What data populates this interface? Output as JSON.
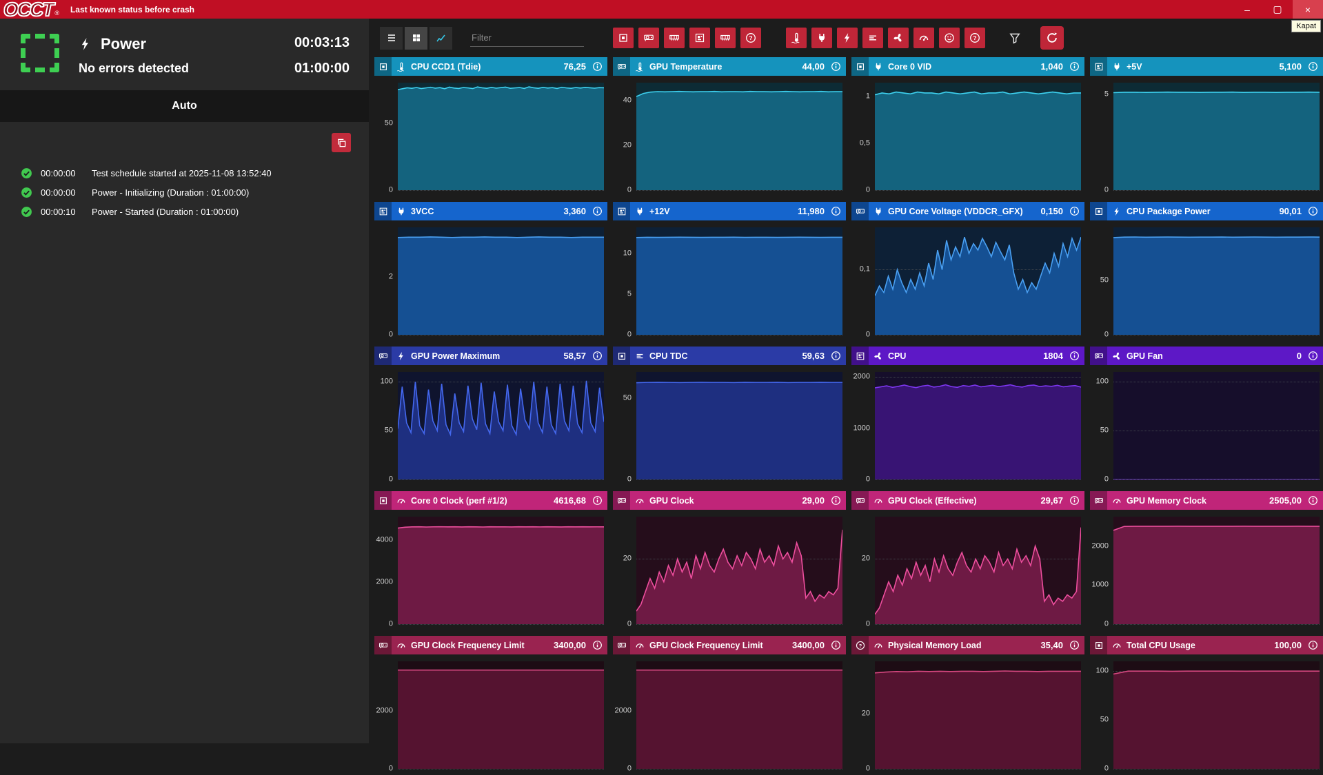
{
  "titlebar": {
    "app_name": "OCCT",
    "registered_mark": "®",
    "status_message": "Last known status before crash",
    "window_controls": {
      "minimize": "–",
      "maximize": "▢",
      "close": "×"
    },
    "close_tooltip": "Kapat"
  },
  "sidebar": {
    "test_type": "Power",
    "status": "No errors detected",
    "elapsed": "00:03:13",
    "total": "01:00:00",
    "mode_label": "Auto",
    "log": [
      {
        "time": "00:00:00",
        "message": "Test schedule started at 2025-11-08 13:52:40"
      },
      {
        "time": "00:00:00",
        "message": "Power - Initializing (Duration : 01:00:00)"
      },
      {
        "time": "00:00:10",
        "message": "Power - Started (Duration : 01:00:00)"
      }
    ]
  },
  "toolbar": {
    "filter_placeholder": "Filter",
    "view_buttons": [
      "list-view",
      "grid-view",
      "chart-view"
    ],
    "active_view": "grid-view",
    "source_filters": [
      "cpu",
      "gpu",
      "memory",
      "mainboard",
      "dimm",
      "unknown"
    ],
    "type_filters": [
      "temperature",
      "voltage",
      "power",
      "current",
      "fan",
      "frequency",
      "load",
      "unknown"
    ]
  },
  "themes": {
    "teal": {
      "header": "#1593bd",
      "plot_bg": "#0d2b35",
      "fill": "#14637e",
      "line": "#3ed2f0"
    },
    "blue": {
      "header": "#1565cd",
      "plot_bg": "#0d2036",
      "fill": "#155093",
      "line": "#4aa0f2"
    },
    "navy": {
      "header": "#2b3ba6",
      "plot_bg": "#0f142e",
      "fill": "#1e2f80",
      "line": "#4468ee"
    },
    "purple": {
      "header": "#5d18c6",
      "plot_bg": "#160e2b",
      "fill": "#381474",
      "line": "#7c36ee"
    },
    "magenta": {
      "header": "#c02579",
      "plot_bg": "#250d1b",
      "fill": "#6e1a44",
      "line": "#ee4f9e"
    },
    "maroon": {
      "header": "#9a2350",
      "plot_bg": "#1d0c14",
      "fill": "#551330",
      "line": "#d64880"
    }
  },
  "charts": [
    {
      "name": "CPU CCD1 (Tdie)",
      "value": "76,25",
      "theme": "teal",
      "source": "cpu",
      "type": "temperature",
      "ymax": 80,
      "ticks": [
        {
          "value": 50,
          "label": "50"
        },
        {
          "value": 0,
          "label": "0"
        }
      ],
      "series": [
        74.8,
        75.5,
        76.2,
        75.8,
        76.4,
        75.6,
        76.1,
        76.6,
        75.9,
        76.3,
        75.5,
        76.7,
        76.0,
        75.7,
        76.4,
        76.1,
        75.6,
        76.8,
        76.2,
        75.8,
        76.5,
        75.9,
        76.3,
        76.7,
        75.8,
        76.1,
        76.4,
        75.7,
        76.9,
        76.2,
        75.8,
        76.5,
        76.0,
        76.3,
        75.7,
        76.6,
        76.1,
        75.8,
        76.4,
        76.0,
        76.5,
        76.2,
        75.9,
        76.3,
        76.2
      ]
    },
    {
      "name": "GPU Temperature",
      "value": "44,00",
      "theme": "teal",
      "source": "gpu",
      "type": "temperature",
      "ymax": 48,
      "ticks": [
        {
          "value": 40,
          "label": "40"
        },
        {
          "value": 20,
          "label": "20"
        },
        {
          "value": 0,
          "label": "0"
        }
      ],
      "series": [
        41.8,
        43.2,
        43.8,
        44,
        43.9,
        44,
        44.1,
        44,
        43.9,
        44,
        44,
        44.1,
        43.9,
        44,
        44,
        43.9,
        44.1,
        44,
        44,
        43.9,
        44,
        44.1,
        44,
        43.9,
        44,
        44,
        44.1,
        43.9,
        44,
        44
      ]
    },
    {
      "name": "Core 0 VID",
      "value": "1,040",
      "theme": "teal",
      "source": "cpu",
      "type": "voltage",
      "ymax": 1.15,
      "ticks": [
        {
          "value": 1,
          "label": "1"
        },
        {
          "value": 0.5,
          "label": "0,5"
        },
        {
          "value": 0,
          "label": "0"
        }
      ],
      "series": [
        1.02,
        1.04,
        1.03,
        1.05,
        1.04,
        1.03,
        1.05,
        1.04,
        1.04,
        1.03,
        1.05,
        1.04,
        1.03,
        1.04,
        1.05,
        1.03,
        1.04,
        1.04,
        1.05,
        1.03,
        1.04,
        1.05,
        1.04,
        1.03,
        1.04,
        1.05,
        1.04,
        1.03,
        1.04,
        1.04
      ]
    },
    {
      "name": "+5V",
      "value": "5,100",
      "theme": "teal",
      "source": "mainboard",
      "type": "voltage",
      "ymax": 5.6,
      "ticks": [
        {
          "value": 5,
          "label": "5"
        },
        {
          "value": 0,
          "label": "0"
        }
      ],
      "series": [
        5.08,
        5.1,
        5.1,
        5.09,
        5.1,
        5.11,
        5.1,
        5.1,
        5.09,
        5.1,
        5.1,
        5.11,
        5.09,
        5.1,
        5.1,
        5.09,
        5.1,
        5.1,
        5.11,
        5.1
      ]
    },
    {
      "name": "3VCC",
      "value": "3,360",
      "theme": "blue",
      "source": "mainboard",
      "type": "voltage",
      "ymax": 3.7,
      "ticks": [
        {
          "value": 2,
          "label": "2"
        },
        {
          "value": 0,
          "label": "0"
        }
      ],
      "series": [
        3.35,
        3.36,
        3.36,
        3.37,
        3.36,
        3.35,
        3.36,
        3.36,
        3.37,
        3.36,
        3.36,
        3.35,
        3.36,
        3.37,
        3.36,
        3.36,
        3.35,
        3.36,
        3.36,
        3.36
      ]
    },
    {
      "name": "+12V",
      "value": "11,980",
      "theme": "blue",
      "source": "mainboard",
      "type": "voltage",
      "ymax": 13.2,
      "ticks": [
        {
          "value": 10,
          "label": "10"
        },
        {
          "value": 5,
          "label": "5"
        },
        {
          "value": 0,
          "label": "0"
        }
      ],
      "series": [
        11.95,
        11.98,
        11.97,
        11.98,
        11.99,
        11.98,
        11.97,
        11.98,
        11.98,
        11.99,
        11.97,
        11.98,
        11.98,
        11.97,
        11.98,
        11.99,
        11.98,
        11.97,
        11.98,
        11.98
      ]
    },
    {
      "name": "GPU Core Voltage (VDDCR_GFX)",
      "value": "0,150",
      "theme": "blue",
      "source": "gpu",
      "type": "voltage",
      "ymax": 0.165,
      "ticks": [
        {
          "value": 0.1,
          "label": "0,1"
        },
        {
          "value": 0,
          "label": "0"
        }
      ],
      "series": [
        0.06,
        0.075,
        0.065,
        0.09,
        0.07,
        0.1,
        0.08,
        0.065,
        0.085,
        0.07,
        0.095,
        0.075,
        0.11,
        0.085,
        0.13,
        0.1,
        0.145,
        0.115,
        0.135,
        0.12,
        0.15,
        0.125,
        0.14,
        0.13,
        0.148,
        0.135,
        0.12,
        0.142,
        0.128,
        0.115,
        0.138,
        0.095,
        0.07,
        0.085,
        0.065,
        0.08,
        0.07,
        0.09,
        0.11,
        0.095,
        0.125,
        0.105,
        0.14,
        0.12,
        0.148,
        0.13,
        0.15
      ]
    },
    {
      "name": "CPU Package Power",
      "value": "90,01",
      "theme": "blue",
      "source": "cpu",
      "type": "power",
      "ymax": 99,
      "ticks": [
        {
          "value": 50,
          "label": "50"
        },
        {
          "value": 0,
          "label": "0"
        }
      ],
      "series": [
        89.5,
        90,
        90.1,
        89.9,
        90,
        90.1,
        90,
        89.9,
        90,
        90,
        90.1,
        89.9,
        90,
        90.1,
        90,
        89.9,
        90,
        90,
        90.1,
        90
      ]
    },
    {
      "name": "GPU Power Maximum",
      "value": "58,57",
      "theme": "navy",
      "source": "gpu",
      "type": "power",
      "ymax": 110,
      "ticks": [
        {
          "value": 100,
          "label": "100"
        },
        {
          "value": 50,
          "label": "50"
        },
        {
          "value": 0,
          "label": "0"
        }
      ],
      "series": [
        52,
        95,
        58,
        48,
        100,
        55,
        47,
        92,
        60,
        50,
        98,
        56,
        46,
        88,
        58,
        49,
        96,
        62,
        51,
        99,
        57,
        47,
        90,
        59,
        50,
        97,
        55,
        46,
        93,
        61,
        52,
        100,
        58,
        48,
        95,
        56,
        47,
        98,
        60,
        50,
        96,
        57,
        48,
        101,
        58,
        49,
        94,
        59
      ]
    },
    {
      "name": "CPU TDC",
      "value": "59,63",
      "theme": "navy",
      "source": "cpu",
      "type": "current",
      "ymax": 66,
      "ticks": [
        {
          "value": 50,
          "label": "50"
        },
        {
          "value": 0,
          "label": "0"
        }
      ],
      "series": [
        59.4,
        59.6,
        59.7,
        59.6,
        59.5,
        59.6,
        59.7,
        59.6,
        59.6,
        59.5,
        59.7,
        59.6,
        59.6,
        59.7,
        59.5,
        59.6,
        59.6,
        59.7,
        59.6,
        59.6
      ]
    },
    {
      "name": "CPU",
      "value": "1804",
      "theme": "purple",
      "source": "mainboard",
      "type": "fan",
      "ymax": 2100,
      "ticks": [
        {
          "value": 2000,
          "label": "2000"
        },
        {
          "value": 1000,
          "label": "1000"
        },
        {
          "value": 0,
          "label": "0"
        }
      ],
      "series": [
        1790,
        1810,
        1830,
        1800,
        1820,
        1845,
        1815,
        1795,
        1825,
        1840,
        1805,
        1820,
        1850,
        1815,
        1800,
        1835,
        1820,
        1845,
        1810,
        1825,
        1840,
        1815,
        1830,
        1850,
        1820,
        1805,
        1835,
        1845,
        1815,
        1830,
        1820,
        1840,
        1810,
        1825,
        1835,
        1804
      ]
    },
    {
      "name": "GPU Fan",
      "value": "0",
      "theme": "purple",
      "source": "gpu",
      "type": "fan",
      "ymax": 110,
      "ticks": [
        {
          "value": 100,
          "label": "100"
        },
        {
          "value": 50,
          "label": "50"
        },
        {
          "value": 0,
          "label": "0"
        }
      ],
      "series": [
        0,
        0,
        0,
        0,
        0,
        0,
        0,
        0,
        0,
        0,
        0,
        0,
        0,
        0,
        0
      ]
    },
    {
      "name": "Core 0 Clock (perf #1/2)",
      "value": "4616,68",
      "theme": "magenta",
      "source": "cpu",
      "type": "frequency",
      "ymax": 5100,
      "ticks": [
        {
          "value": 4000,
          "label": "4000"
        },
        {
          "value": 2000,
          "label": "2000"
        },
        {
          "value": 0,
          "label": "0"
        }
      ],
      "series": [
        4560,
        4600,
        4615,
        4620,
        4610,
        4618,
        4622,
        4615,
        4619,
        4612,
        4620,
        4616,
        4610,
        4621,
        4615,
        4618,
        4613,
        4620,
        4616,
        4619,
        4614,
        4621,
        4617,
        4612,
        4619,
        4616,
        4620,
        4615,
        4618,
        4617
      ]
    },
    {
      "name": "GPU Clock",
      "value": "29,00",
      "theme": "magenta",
      "source": "gpu",
      "type": "frequency",
      "ymax": 33,
      "ticks": [
        {
          "value": 20,
          "label": "20"
        },
        {
          "value": 0,
          "label": "0"
        }
      ],
      "series": [
        4,
        6,
        10,
        14,
        11,
        16,
        13,
        18,
        15,
        20,
        16,
        19,
        14,
        21,
        17,
        22,
        18,
        16,
        20,
        23,
        19,
        17,
        21,
        18,
        22,
        20,
        17,
        23,
        19,
        21,
        18,
        24,
        20,
        22,
        19,
        25,
        21,
        8,
        10,
        7,
        9,
        8,
        10,
        9,
        11,
        29
      ]
    },
    {
      "name": "GPU Clock (Effective)",
      "value": "29,67",
      "theme": "magenta",
      "source": "gpu",
      "type": "frequency",
      "ymax": 33,
      "ticks": [
        {
          "value": 20,
          "label": "20"
        },
        {
          "value": 0,
          "label": "0"
        }
      ],
      "series": [
        3,
        5,
        9,
        13,
        10,
        15,
        12,
        17,
        14,
        19,
        15,
        18,
        13,
        20,
        16,
        21,
        17,
        15,
        19,
        22,
        18,
        16,
        20,
        17,
        21,
        19,
        16,
        22,
        18,
        20,
        17,
        23,
        19,
        21,
        18,
        24,
        20,
        7,
        9,
        6,
        8,
        7,
        9,
        8,
        10,
        29.7
      ]
    },
    {
      "name": "GPU Memory Clock",
      "value": "2505,00",
      "theme": "magenta",
      "source": "gpu",
      "type": "frequency",
      "ymax": 2750,
      "ticks": [
        {
          "value": 2000,
          "label": "2000"
        },
        {
          "value": 1000,
          "label": "1000"
        },
        {
          "value": 0,
          "label": "0"
        }
      ],
      "series": [
        2400,
        2500,
        2505,
        2505,
        2504,
        2505,
        2506,
        2505,
        2505,
        2504,
        2505,
        2505,
        2506,
        2504,
        2505,
        2505,
        2505,
        2506,
        2505,
        2505
      ]
    },
    {
      "name": "GPU Clock Frequency Limit",
      "value": "3400,00",
      "theme": "maroon",
      "source": "gpu",
      "type": "frequency",
      "ymax": 3700,
      "ticks": [
        {
          "value": 2000,
          "label": "2000"
        },
        {
          "value": 0,
          "label": "0"
        }
      ],
      "series": [
        3400,
        3400,
        3400,
        3400,
        3400,
        3400,
        3400,
        3400,
        3400,
        3400,
        3400,
        3400,
        3400,
        3400,
        3400
      ]
    },
    {
      "name": "GPU Clock Frequency Limit",
      "value": "3400,00",
      "theme": "maroon",
      "source": "gpu",
      "type": "frequency",
      "ymax": 3700,
      "ticks": [
        {
          "value": 2000,
          "label": "2000"
        },
        {
          "value": 0,
          "label": "0"
        }
      ],
      "series": [
        3400,
        3400,
        3400,
        3400,
        3400,
        3400,
        3400,
        3400,
        3400,
        3400,
        3400,
        3400,
        3400,
        3400,
        3400
      ]
    },
    {
      "name": "Physical Memory Load",
      "value": "35,40",
      "theme": "maroon",
      "source": "unknown",
      "type": "usage",
      "ymax": 39,
      "ticks": [
        {
          "value": 20,
          "label": "20"
        },
        {
          "value": 0,
          "label": "0"
        }
      ],
      "series": [
        34.8,
        35.1,
        35.3,
        35.2,
        35.4,
        35.3,
        35.4,
        35.3,
        35.4,
        35.4,
        35.3,
        35.4,
        35.5,
        35.4,
        35.4,
        35.3,
        35.4,
        35.4,
        35.4,
        35.4
      ]
    },
    {
      "name": "Total CPU Usage",
      "value": "100,00",
      "theme": "maroon",
      "source": "cpu",
      "type": "usage",
      "ymax": 110,
      "ticks": [
        {
          "value": 100,
          "label": "100"
        },
        {
          "value": 50,
          "label": "50"
        },
        {
          "value": 0,
          "label": "0"
        }
      ],
      "series": [
        97,
        100,
        100,
        100,
        99.8,
        100,
        100,
        100,
        100,
        99.9,
        100,
        100,
        100,
        100,
        100
      ]
    }
  ]
}
